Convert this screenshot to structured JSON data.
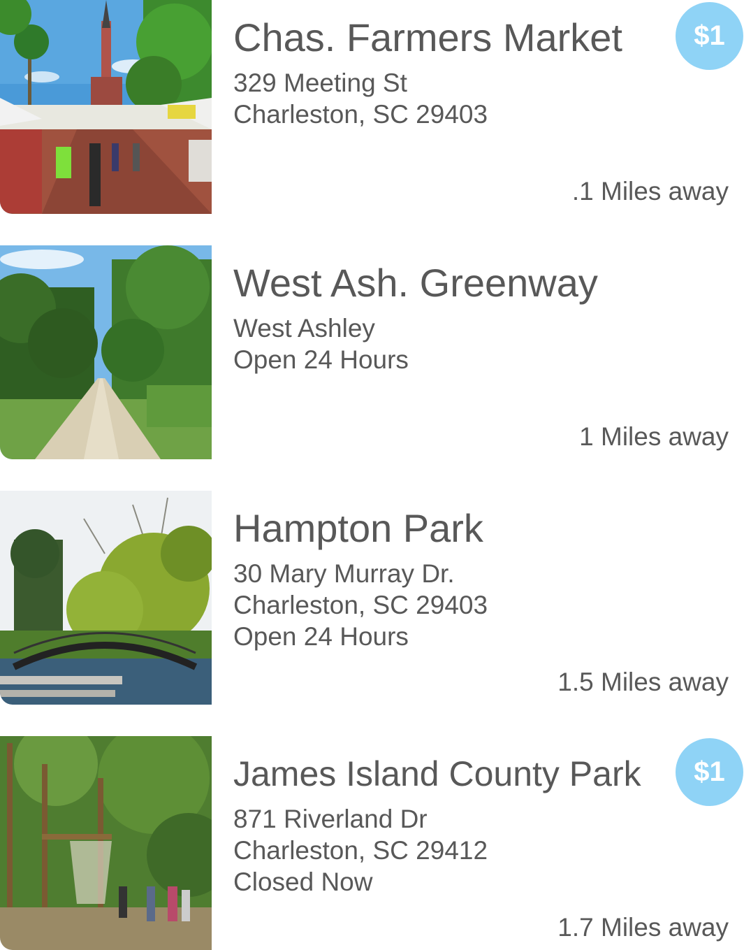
{
  "places": [
    {
      "name": "Chas. Farmers Market",
      "lines": [
        "329 Meeting St",
        "Charleston, SC 29403"
      ],
      "distance": ".1 Miles away",
      "badge": "$1",
      "image_icon": "farmers-market-photo"
    },
    {
      "name": "West Ash. Greenway",
      "lines": [
        "West Ashley",
        "Open 24 Hours"
      ],
      "distance": "1 Miles away",
      "badge": null,
      "image_icon": "greenway-trail-photo"
    },
    {
      "name": "Hampton Park",
      "lines": [
        "30 Mary Murray Dr.",
        "Charleston, SC 29403",
        "Open 24 Hours"
      ],
      "distance": "1.5 Miles away",
      "badge": null,
      "image_icon": "park-bridge-photo"
    },
    {
      "name": "James Island County Park",
      "lines": [
        "871 Riverland Dr",
        "Charleston, SC 29412",
        "Closed Now"
      ],
      "distance": "1.7 Miles away",
      "badge": "$1",
      "image_icon": "ropes-course-photo"
    }
  ],
  "colors": {
    "badge": "#8fd3f6",
    "text": "#585858"
  }
}
